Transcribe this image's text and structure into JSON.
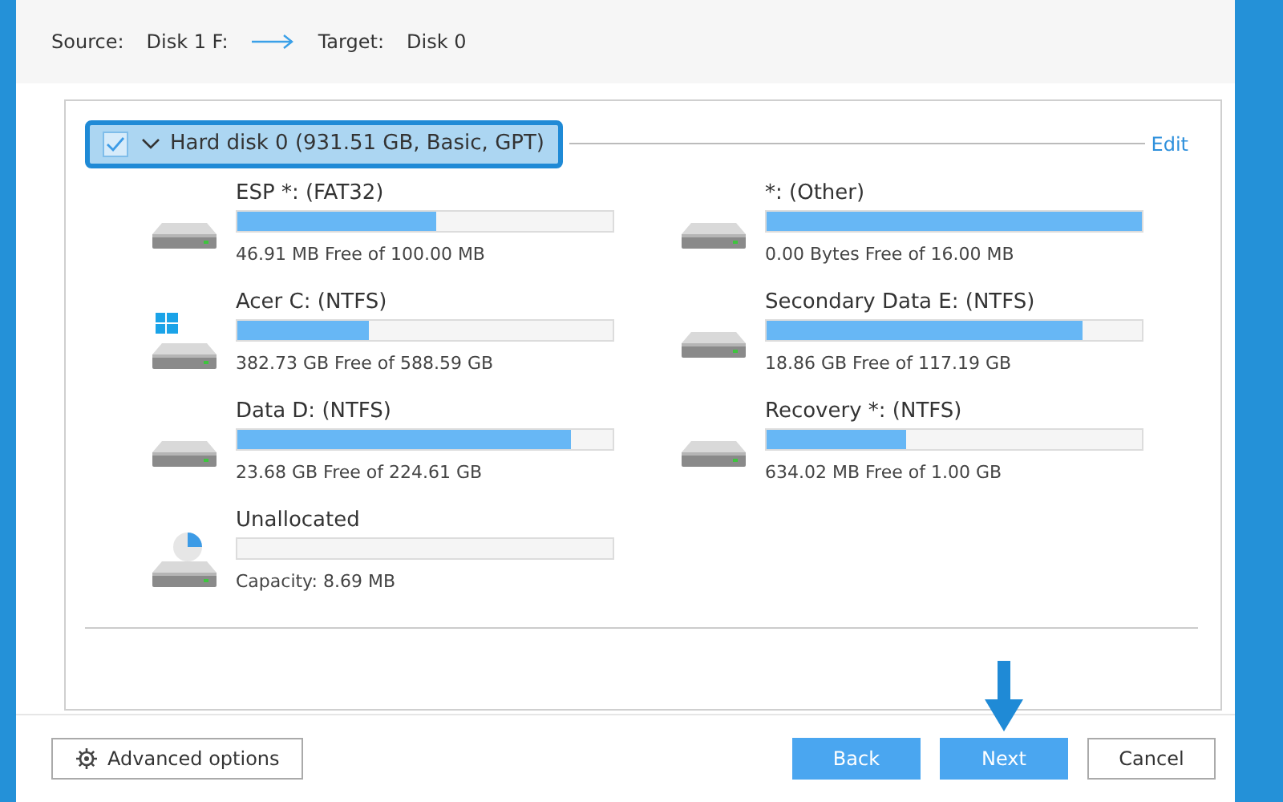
{
  "summary": {
    "source_label": "Source:",
    "source": "Disk 1 F:",
    "target_label": "Target:",
    "target": "Disk 0"
  },
  "disk": {
    "title": "Hard disk 0 (931.51 GB, Basic, GPT)",
    "selected": true,
    "checked": true,
    "expanded": true,
    "edit": "Edit"
  },
  "partitions": [
    {
      "kind": "drive",
      "name": "ESP *: (FAT32)",
      "level": 0.53,
      "detail": "46.91 MB Free of 100.00 MB"
    },
    {
      "kind": "drive",
      "name": "*: (Other)",
      "level": 1,
      "detail": "0.00 Bytes Free of 16.00 MB"
    },
    {
      "kind": "system",
      "name": "Acer C: (NTFS)",
      "level": 0.35,
      "detail": "382.73 GB Free of 588.59 GB"
    },
    {
      "kind": "drive",
      "name": "Secondary Data E: (NTFS)",
      "level": 0.84,
      "detail": "18.86 GB Free of 117.19 GB"
    },
    {
      "kind": "drive",
      "name": "Data  D: (NTFS)",
      "level": 0.89,
      "detail": "23.68 GB Free of 224.61 GB"
    },
    {
      "kind": "drive",
      "name": "Recovery *: (NTFS)",
      "level": 0.37,
      "detail": "634.02 MB Free of 1.00 GB"
    },
    {
      "kind": "unallocated",
      "name": "Unallocated",
      "level": 0,
      "detail": "Capacity: 8.69 MB"
    }
  ],
  "buttons": [
    {
      "kind": "options",
      "label": "Advanced options"
    },
    {
      "kind": "primary",
      "label": "Back"
    },
    {
      "kind": "primary",
      "label": "Next"
    },
    {
      "kind": "secondary",
      "label": "Cancel"
    }
  ]
}
